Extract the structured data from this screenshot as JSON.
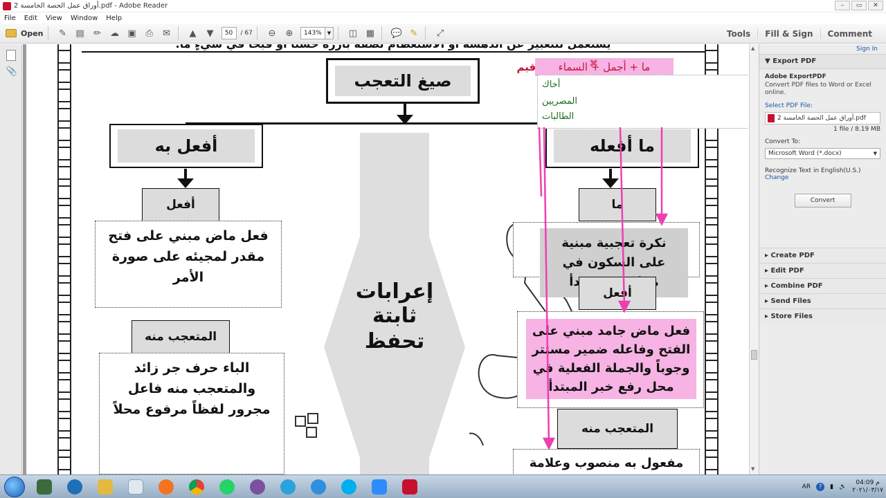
{
  "window": {
    "title": "أوراق عمل الحصة الخامسة 2.pdf - Adobe Reader",
    "controls": [
      "–",
      "▭",
      "✕"
    ]
  },
  "menu": [
    "File",
    "Edit",
    "View",
    "Window",
    "Help"
  ],
  "toolbar": {
    "open_label": "Open",
    "page_current": "50",
    "page_total": "/ 67",
    "zoom": "143%",
    "tools_label": "Tools",
    "fill_sign_label": "Fill & Sign",
    "comment_label": "Comment"
  },
  "document": {
    "top_cut_text": "يستعمل للتعبير عن الدهشة أو الاستعظام لصفة بارزة حسناً أو قبحاً في شيءٍ ما.",
    "title": "صيغ التعجب",
    "left_header": "أفعل به",
    "right_header": "ما أفعله",
    "center_text_line1": "إعرابات ثابتة",
    "center_text_line2": "تحفظ",
    "left_afal_label": "أفعل",
    "left_afal_desc": "فعل ماض مبني على فتح مقدر لمجيئه على صورة الأمر",
    "left_mutaajab_label": "المتعجب منه",
    "left_mutaajab_desc": "الباء حرف جر زائد والمتعجب منه فاعل مجرور لفظاً مرفوع محلاً",
    "right_ma_label": "ما",
    "right_ma_desc": "نكرة تعجبية مبنية على السكون في محل رفع مبتدأ",
    "right_afal_label": "أفعل",
    "right_afal_desc": "فعل ماض جامد مبني على الفتح وفاعله ضمير مستتر وجوباً والجملة الفعلية في محل رفع خبر المبتدأ",
    "right_mutaajab_label": "المتعجب منه",
    "right_mutaajab_desc": "مفعول به منصوب وعلامة",
    "annotation_tarqim": "!ترقيم",
    "annotation_formula": "ما + أجمل + السماء",
    "annotation_words": [
      "أخاك",
      "المصريين",
      "الطالبات"
    ]
  },
  "right_panel": {
    "sign_in": "Sign In",
    "export_header": "Export PDF",
    "export_title": "Adobe ExportPDF",
    "export_desc": "Convert PDF files to Word or Excel online.",
    "select_label": "Select PDF File:",
    "file_name": "أوراق عمل الحصة الخامسة 2.pdf",
    "file_meta": "1 file / 8.19 MB",
    "convert_to_label": "Convert To:",
    "convert_to_value": "Microsoft Word (*.docx)",
    "recognize_text": "Recognize Text in English(U.S.)",
    "change_link": "Change",
    "convert_button": "Convert",
    "sections": [
      "Create PDF",
      "Edit PDF",
      "Combine PDF",
      "Send Files",
      "Store Files"
    ]
  },
  "taskbar": {
    "lang": "AR",
    "time": "04:09 م",
    "date": "٢٠٢١/٠٣/١٧"
  },
  "colors": {
    "pink_highlight": "#f6b3e4",
    "pink_line": "#ee3fb2",
    "annotation_green": "#1a6e1a",
    "annotation_red": "#c0193a",
    "link_blue": "#1a55a8"
  }
}
